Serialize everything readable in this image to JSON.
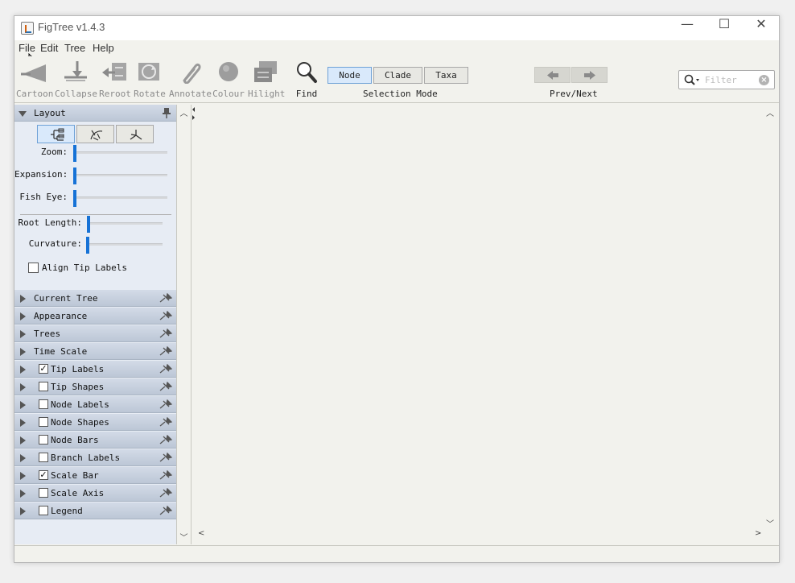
{
  "window": {
    "title": "FigTree v1.4.3",
    "controls": {
      "minimize": "—",
      "maximize": "☐",
      "close": "✕"
    }
  },
  "menu": [
    "File",
    "Edit",
    "Tree",
    "Help"
  ],
  "toolbar": {
    "tools": [
      {
        "label": "Cartoon",
        "icon": "cartoon-icon",
        "enabled": false
      },
      {
        "label": "Collapse",
        "icon": "collapse-icon",
        "enabled": false
      },
      {
        "label": "Reroot",
        "icon": "reroot-icon",
        "enabled": false
      },
      {
        "label": "Rotate",
        "icon": "rotate-icon",
        "enabled": false
      },
      {
        "label": "Annotate",
        "icon": "paperclip-icon",
        "enabled": false
      },
      {
        "label": "Colour",
        "icon": "colour-icon",
        "enabled": false
      },
      {
        "label": "Hilight",
        "icon": "hilight-icon",
        "enabled": false
      },
      {
        "label": "Find",
        "icon": "magnifier-icon",
        "enabled": true
      }
    ],
    "selection_mode": {
      "caption": "Selection Mode",
      "options": [
        "Node",
        "Clade",
        "Taxa"
      ],
      "selected": "Node"
    },
    "prev_next": {
      "caption": "Prev/Next"
    },
    "filter": {
      "placeholder": "Filter",
      "value": ""
    }
  },
  "panel": {
    "layout": {
      "title": "Layout",
      "sliders": [
        {
          "label": "Zoom:",
          "value": 0
        },
        {
          "label": "Expansion:",
          "value": 0
        },
        {
          "label": "Fish Eye:",
          "value": 0
        },
        {
          "label": "Root Length:",
          "value": 0
        },
        {
          "label": "Curvature:",
          "value": 0
        }
      ],
      "align_tip_labels": {
        "label": "Align Tip Labels",
        "checked": false
      }
    },
    "sections": [
      {
        "label": "Current Tree",
        "checkbox": null
      },
      {
        "label": "Appearance",
        "checkbox": null
      },
      {
        "label": "Trees",
        "checkbox": null
      },
      {
        "label": "Time Scale",
        "checkbox": null
      },
      {
        "label": "Tip Labels",
        "checkbox": true
      },
      {
        "label": "Tip Shapes",
        "checkbox": false
      },
      {
        "label": "Node Labels",
        "checkbox": false
      },
      {
        "label": "Node Shapes",
        "checkbox": false
      },
      {
        "label": "Node Bars",
        "checkbox": false
      },
      {
        "label": "Branch Labels",
        "checkbox": false
      },
      {
        "label": "Scale Bar",
        "checkbox": true
      },
      {
        "label": "Scale Axis",
        "checkbox": false
      },
      {
        "label": "Legend",
        "checkbox": false
      }
    ]
  },
  "colors": {
    "accent": "#1672d6",
    "selected_bg": "#d9e9fb",
    "panel_bg": "#e7ecf4",
    "header_bg": "#c5cfdd"
  }
}
